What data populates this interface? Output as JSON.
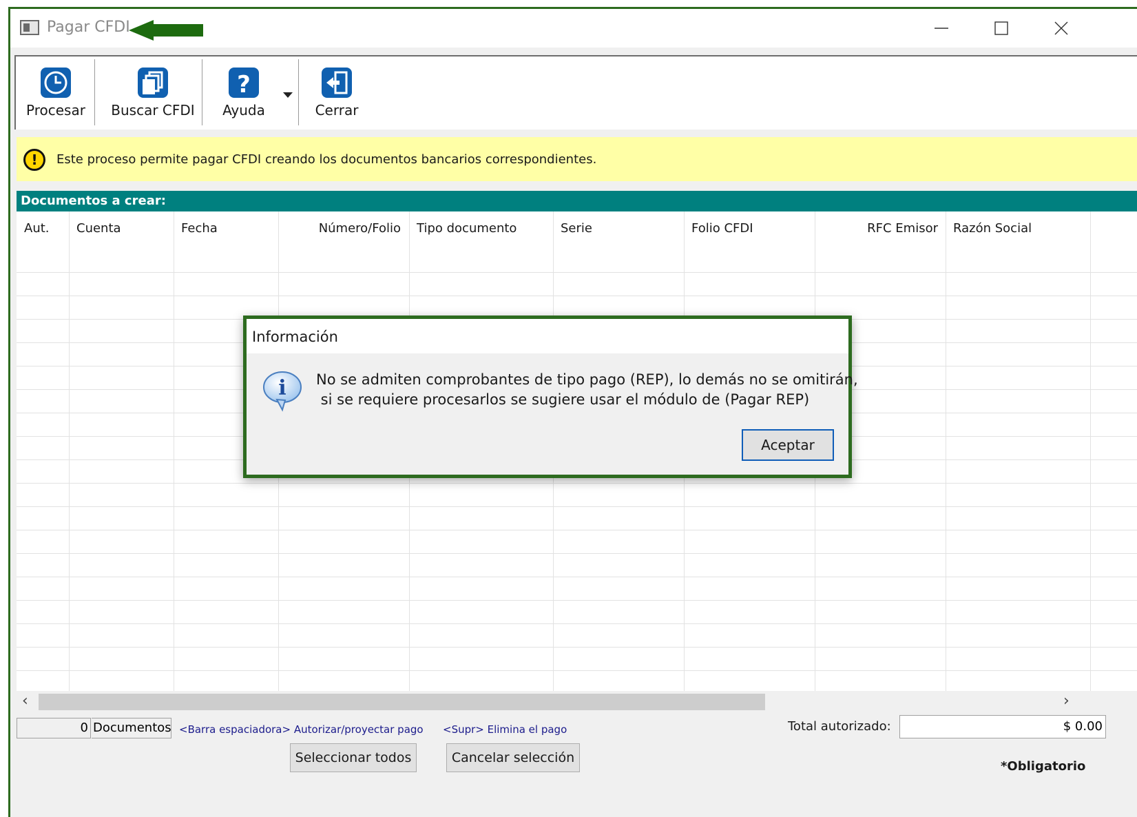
{
  "window": {
    "title": "Pagar CFDI"
  },
  "toolbar": {
    "procesar": "Procesar",
    "buscar": "Buscar CFDI",
    "ayuda": "Ayuda",
    "cerrar": "Cerrar"
  },
  "info_bar": {
    "message": "Este proceso permite pagar CFDI creando los documentos bancarios correspondientes."
  },
  "section": {
    "title": "Documentos a crear:"
  },
  "table": {
    "columns": [
      "Aut.",
      "Cuenta",
      "Fecha",
      "Número/Folio",
      "Tipo documento",
      "Serie",
      "Folio CFDI",
      "RFC Emisor",
      "Razón Social"
    ]
  },
  "status": {
    "count": "0",
    "documents_label": "Documentos",
    "hint_space": "<Barra espaciadora> Autorizar/proyectar pago",
    "hint_supr": "<Supr> Elimina el pago",
    "total_label": "Total autorizado:",
    "total_value": "$ 0.00"
  },
  "buttons": {
    "select_all": "Seleccionar todos",
    "cancel_selection": "Cancelar selección"
  },
  "required_note": "*Obligatorio",
  "dialog": {
    "title": "Información",
    "message": "No se admiten comprobantes de tipo pago (REP), lo demás no se omitirán,\n si se requiere procesarlos se sugiere usar el módulo de (Pagar REP)",
    "ok": "Aceptar"
  },
  "colors": {
    "accent_teal": "#00807f",
    "annotation_green": "#2d6b1f",
    "info_yellow": "#ffffa6",
    "icon_blue": "#1060b0"
  },
  "icons": [
    "window-icon",
    "green-arrow-icon",
    "clock-icon",
    "documents-icon",
    "help-icon",
    "exit-icon",
    "warning-icon",
    "info-balloon-icon"
  ]
}
